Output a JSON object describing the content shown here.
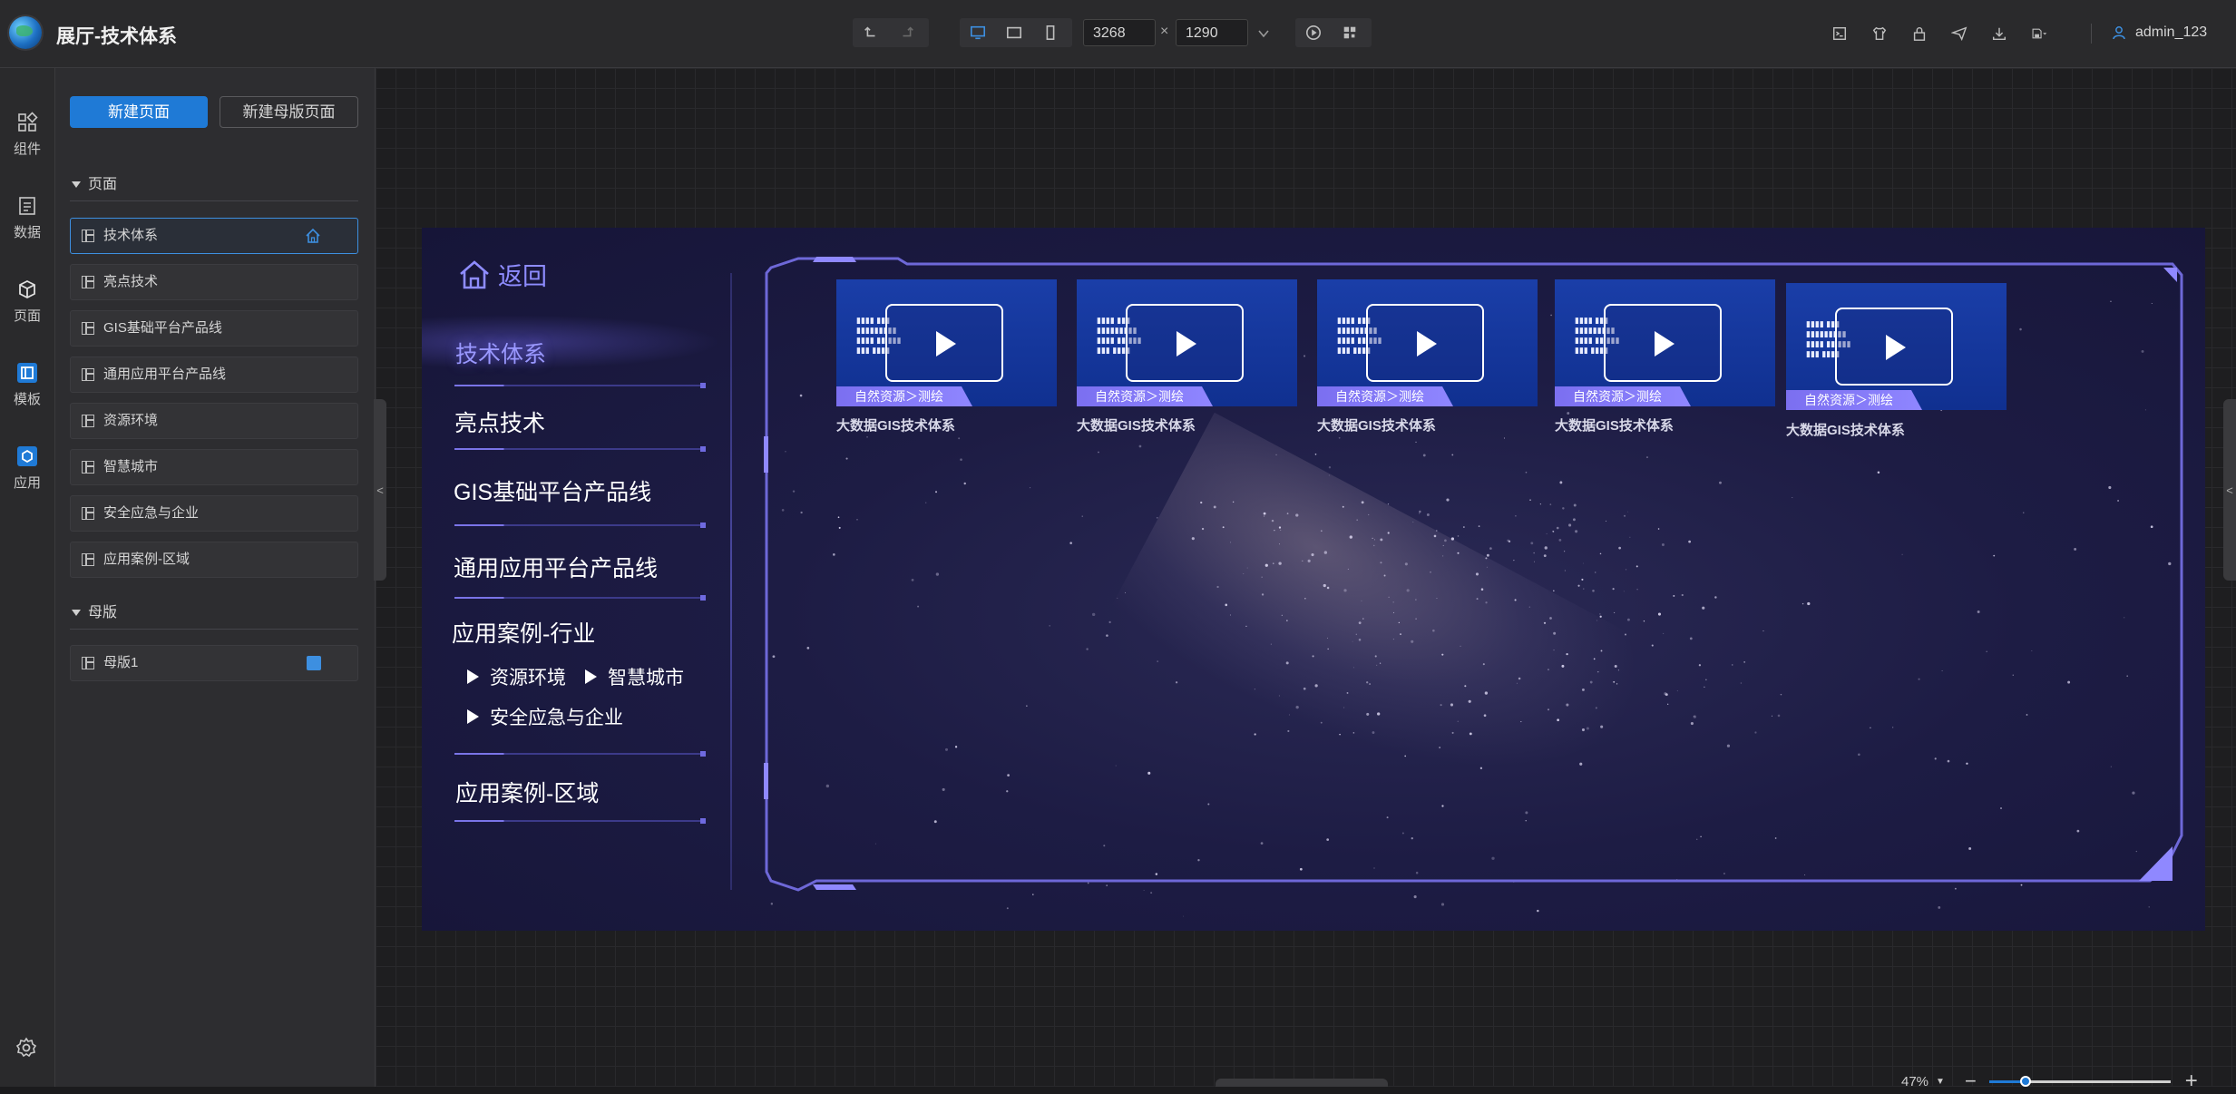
{
  "app": {
    "title": "展厅-技术体系"
  },
  "toolbar": {
    "width_value": "3268",
    "height_value": "1290",
    "dim_separator": "×",
    "user_name": "admin_123"
  },
  "rail": {
    "items": [
      {
        "label": "组件",
        "icon": "components-icon"
      },
      {
        "label": "数据",
        "icon": "data-icon"
      },
      {
        "label": "页面",
        "icon": "pages-icon"
      },
      {
        "label": "模板",
        "icon": "template-icon"
      },
      {
        "label": "应用",
        "icon": "app-icon"
      }
    ]
  },
  "panel": {
    "new_page_label": "新建页面",
    "new_master_label": "新建母版页面",
    "pages_section_label": "页面",
    "pages": [
      {
        "label": "技术体系"
      },
      {
        "label": "亮点技术"
      },
      {
        "label": "GIS基础平台产品线"
      },
      {
        "label": "通用应用平台产品线"
      },
      {
        "label": "资源环境"
      },
      {
        "label": "智慧城市"
      },
      {
        "label": "安全应急与企业"
      },
      {
        "label": "应用案例-区域"
      }
    ],
    "masters_section_label": "母版",
    "masters": [
      {
        "label": "母版1"
      }
    ]
  },
  "stage": {
    "back_label": "返回",
    "nav": [
      {
        "label": "技术体系"
      },
      {
        "label": "亮点技术"
      },
      {
        "label": "GIS基础平台产品线"
      },
      {
        "label": "通用应用平台产品线"
      },
      {
        "label": "应用案例-行业"
      },
      {
        "label": "应用案例-区域"
      }
    ],
    "industry_items": [
      {
        "label": "资源环境"
      },
      {
        "label": "智慧城市"
      },
      {
        "label": "安全应急与企业"
      }
    ],
    "videos": [
      {
        "caption": "大数据GIS技术体系",
        "tag": "自然资源＞测绘"
      },
      {
        "caption": "大数据GIS技术体系",
        "tag": "自然资源＞测绘"
      },
      {
        "caption": "大数据GIS技术体系",
        "tag": "自然资源＞测绘"
      },
      {
        "caption": "大数据GIS技术体系",
        "tag": "自然资源＞测绘"
      },
      {
        "caption": "大数据GIS技术体系",
        "tag": "自然资源＞测绘"
      }
    ]
  },
  "zoom": {
    "value": "47%",
    "level": 0.2
  },
  "colors": {
    "accent": "#1f7ad6",
    "nav_active": "#9a98ff",
    "tag": "#7b6ff0"
  }
}
